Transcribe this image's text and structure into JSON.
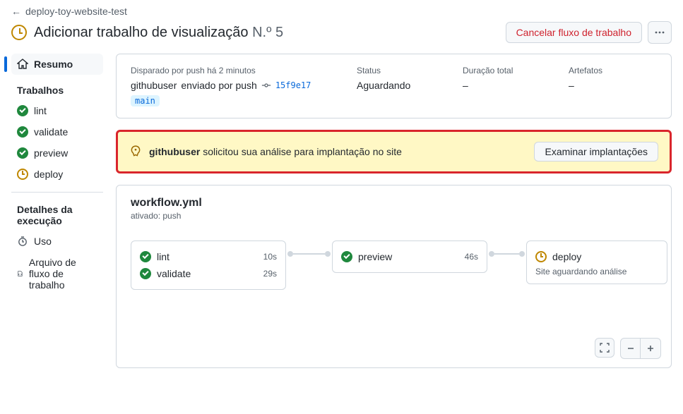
{
  "back": {
    "label": "deploy-toy-website-test"
  },
  "header": {
    "title": "Adicionar trabalho de visualização",
    "run_number": "N.º 5",
    "cancel_label": "Cancelar fluxo de trabalho"
  },
  "sidebar": {
    "summary_label": "Resumo",
    "jobs_heading": "Trabalhos",
    "jobs": [
      {
        "name": "lint",
        "status": "success"
      },
      {
        "name": "validate",
        "status": "success"
      },
      {
        "name": "preview",
        "status": "success"
      },
      {
        "name": "deploy",
        "status": "waiting"
      }
    ],
    "details_heading": "Detalhes da execução",
    "usage_label": "Uso",
    "workflow_file_label": "Arquivo de fluxo de trabalho"
  },
  "summary": {
    "trigger_label": "Disparado por push há 2 minutos",
    "author": "githubuser",
    "trigger_suffix": "enviado por push",
    "sha": "15f9e17",
    "branch": "main",
    "status_label": "Status",
    "status_value": "Aguardando",
    "duration_label": "Duração total",
    "duration_value": "–",
    "artifacts_label": "Artefatos",
    "artifacts_value": "–"
  },
  "review": {
    "requester": "githubuser",
    "text_suffix": "solicitou sua análise para implantação no site",
    "button_label": "Examinar implantações"
  },
  "workflow": {
    "filename": "workflow.yml",
    "trigger_line": "ativado: push",
    "nodes": {
      "group1": [
        {
          "name": "lint",
          "time": "10s"
        },
        {
          "name": "validate",
          "time": "29s"
        }
      ],
      "preview": {
        "name": "preview",
        "time": "46s"
      },
      "deploy": {
        "name": "deploy",
        "subtitle": "Site aguardando análise"
      }
    }
  }
}
